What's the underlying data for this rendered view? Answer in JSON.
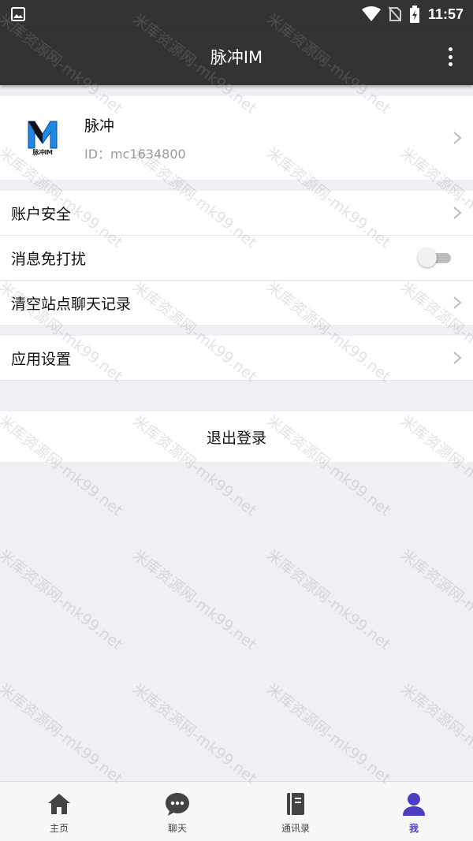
{
  "status_bar": {
    "time": "11:57",
    "icons": [
      "image-icon",
      "wifi-icon",
      "no-sim-icon",
      "battery-charging-icon"
    ]
  },
  "app_bar": {
    "title": "脉冲IM",
    "menu_icon": "more-vertical-icon"
  },
  "profile": {
    "name": "脉冲",
    "id_text": "ID：mc1634800",
    "avatar_letter": "M",
    "avatar_caption": "脉冲IM"
  },
  "settings": {
    "account_security": "账户安全",
    "do_not_disturb": "消息免打扰",
    "do_not_disturb_on": false,
    "clear_chat_history": "清空站点聊天记录",
    "app_settings": "应用设置"
  },
  "logout_label": "退出登录",
  "tabs": [
    {
      "label": "主页",
      "icon": "home-icon",
      "active": false
    },
    {
      "label": "聊天",
      "icon": "chat-bubble-icon",
      "active": false
    },
    {
      "label": "通讯录",
      "icon": "contacts-book-icon",
      "active": false
    },
    {
      "label": "我",
      "icon": "person-icon",
      "active": true
    }
  ],
  "colors": {
    "bar_background": "#333333",
    "page_background": "#efeff4",
    "accent": "#4b3ec2",
    "avatar_blue": "#1e88e5"
  },
  "watermark": "米库资源网-mk99.net"
}
